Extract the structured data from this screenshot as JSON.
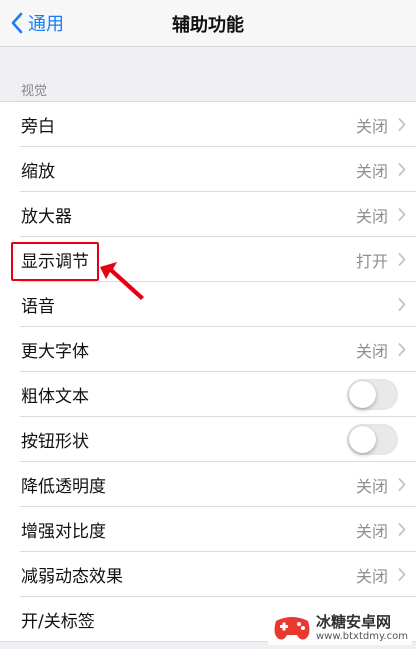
{
  "navbar": {
    "back_label": "通用",
    "title": "辅助功能"
  },
  "section": {
    "header": "视觉"
  },
  "rows": [
    {
      "label": "旁白",
      "value": "关闭",
      "control": "chevron"
    },
    {
      "label": "缩放",
      "value": "关闭",
      "control": "chevron"
    },
    {
      "label": "放大器",
      "value": "关闭",
      "control": "chevron"
    },
    {
      "label": "显示调节",
      "value": "打开",
      "control": "chevron"
    },
    {
      "label": "语音",
      "value": "",
      "control": "chevron"
    },
    {
      "label": "更大字体",
      "value": "关闭",
      "control": "chevron"
    },
    {
      "label": "粗体文本",
      "value": "",
      "control": "toggle",
      "on": false
    },
    {
      "label": "按钮形状",
      "value": "",
      "control": "toggle",
      "on": false
    },
    {
      "label": "降低透明度",
      "value": "关闭",
      "control": "chevron"
    },
    {
      "label": "增强对比度",
      "value": "关闭",
      "control": "chevron"
    },
    {
      "label": "减弱动态效果",
      "value": "关闭",
      "control": "chevron"
    },
    {
      "label": "开/关标签",
      "value": "",
      "control": "chevron"
    }
  ],
  "annotation": {
    "color": "#e60012"
  },
  "watermark": {
    "name": "冰糖安卓网",
    "url": "www.btxtdmy.com"
  },
  "colors": {
    "accent": "#1a7cf6",
    "secondary_text": "#8e8e93"
  }
}
